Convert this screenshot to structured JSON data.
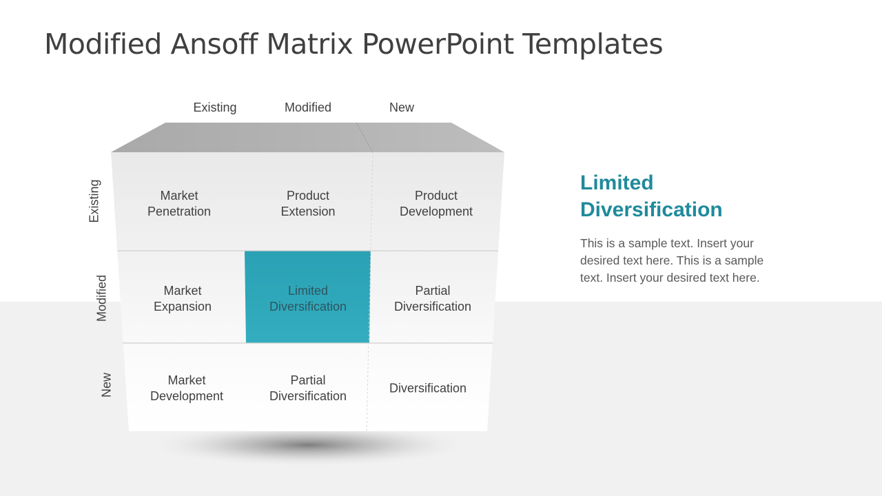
{
  "slide": {
    "title": "Modified Ansoff Matrix PowerPoint Templates"
  },
  "matrix": {
    "column_headers": [
      "Existing",
      "Modified",
      "New"
    ],
    "row_headers": [
      "Existing",
      "Modified",
      "New"
    ],
    "rows": [
      [
        "Market\nPenetration",
        "Product\nExtension",
        "Product\nDevelopment"
      ],
      [
        "Market\nExpansion",
        "Limited\nDiversification",
        "Partial\nDiversification"
      ],
      [
        "Market\nDevelopment",
        "Partial\nDiversification",
        "Diversification"
      ]
    ],
    "highlighted_cell": {
      "row": 1,
      "col": 1
    },
    "highlight_color": "#2ea5b8"
  },
  "detail": {
    "heading": "Limited Diversification",
    "body": "This is a sample text. Insert your desired text here. This is a sample text. Insert your desired text here.",
    "heading_color": "#1f8a9b"
  }
}
